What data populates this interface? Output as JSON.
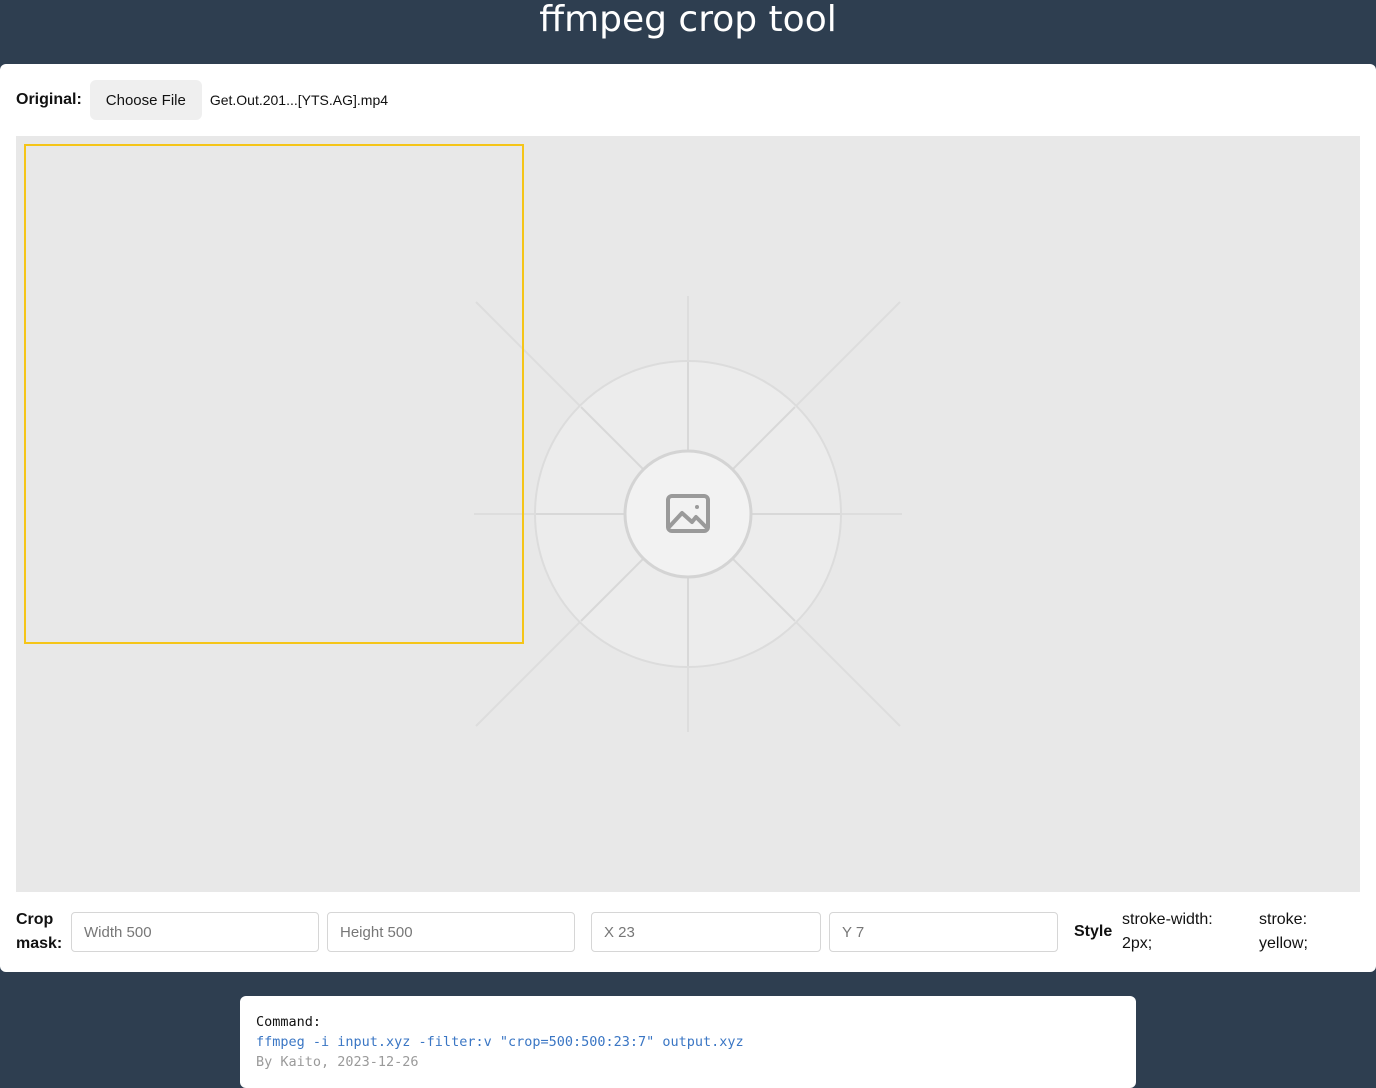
{
  "app": {
    "title": "ffmpeg crop tool"
  },
  "original": {
    "label": "Original:",
    "choose_file_label": "Choose File",
    "file_name": "Get.Out.201...[YTS.AG].mp4"
  },
  "preview": {
    "placeholder_icon": "image-icon",
    "crop_rect_color": "#f5c518"
  },
  "crop_mask": {
    "label": "Crop mask:",
    "width_placeholder": "Width 500",
    "height_placeholder": "Height 500",
    "x_placeholder": "X 23",
    "y_placeholder": "Y 7"
  },
  "style": {
    "label": "Style",
    "stroke_width": "stroke-width: 2px;",
    "stroke": "stroke: yellow;"
  },
  "command": {
    "label": "Command:",
    "text": "ffmpeg -i input.xyz -filter:v \"crop=500:500:23:7\" output.xyz",
    "byline": "By Kaito, 2023-12-26"
  },
  "colors": {
    "header_bg": "#2e3e50",
    "accent": "#f5c518",
    "command_text": "#3a76c4"
  }
}
